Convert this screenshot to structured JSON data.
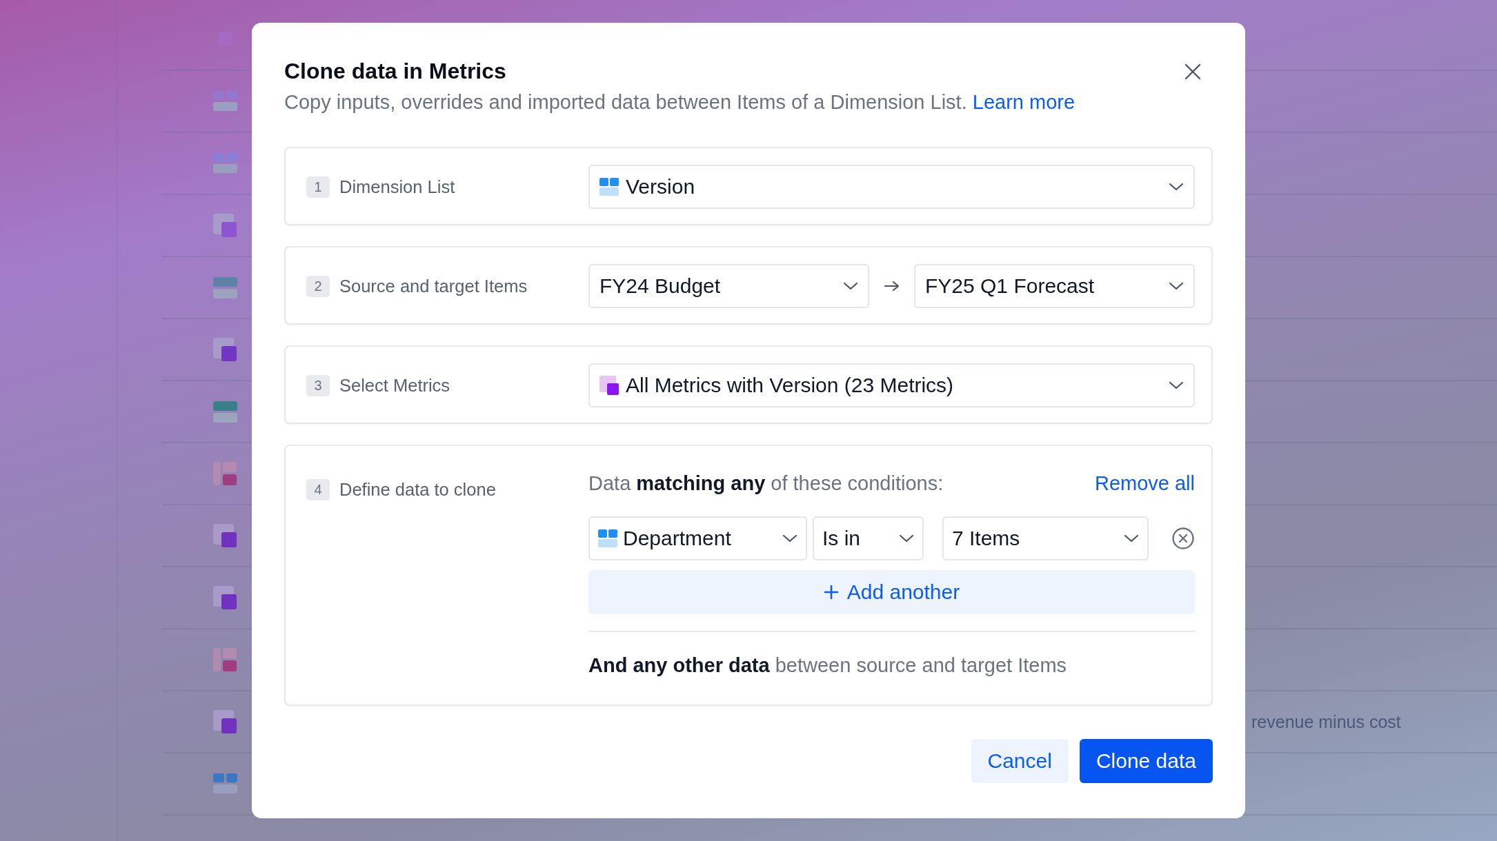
{
  "background": {
    "rows": [
      {
        "kind": "square",
        "color": "#a56ac4"
      },
      {
        "kind": "grid",
        "color": "#9477cf"
      },
      {
        "kind": "grid",
        "color": "#8a7fd6"
      },
      {
        "kind": "metric",
        "color": "#8e55cf"
      },
      {
        "kind": "table",
        "color": "#5c82a6"
      },
      {
        "kind": "metric",
        "color": "#7336c2"
      },
      {
        "kind": "table",
        "color": "#3a7f8c"
      },
      {
        "kind": "split",
        "color": "#a23c80"
      },
      {
        "kind": "metric",
        "color": "#7232c0"
      },
      {
        "kind": "metric",
        "color": "#7232c0"
      },
      {
        "kind": "split",
        "color": "#a23c80"
      },
      {
        "kind": "metric",
        "color": "#7232c0",
        "description": "revenue minus cost"
      },
      {
        "kind": "grid",
        "color": "#3a78c4"
      }
    ]
  },
  "dialog": {
    "title": "Clone data in Metrics",
    "subtitle": "Copy inputs, overrides and imported data between Items of a Dimension List.",
    "learn_more": "Learn more",
    "sections": [
      {
        "kind": "dimension_select",
        "number": "1",
        "label": "Dimension List",
        "value": "Version"
      },
      {
        "kind": "pair",
        "number": "2",
        "label": "Source and target Items",
        "source": "FY24 Budget",
        "target": "FY25 Q1 Forecast"
      },
      {
        "kind": "metric_select",
        "number": "3",
        "label": "Select Metrics",
        "value": "All Metrics with Version (23 Metrics)"
      },
      {
        "kind": "conditions",
        "number": "4",
        "label": "Define data to clone",
        "intro": "Data **matching any** of these conditions:",
        "remove_all": "Remove all",
        "conditions": [
          {
            "kind": "dimension",
            "dimension": "Department",
            "operator": "Is in",
            "values": "7 Items"
          }
        ],
        "add": "Add another",
        "footer": "**And any other data** between source and target Items"
      }
    ],
    "buttons": [
      {
        "kind": "secondary",
        "label": "Cancel"
      },
      {
        "kind": "primary",
        "label": "Clone data"
      }
    ]
  }
}
